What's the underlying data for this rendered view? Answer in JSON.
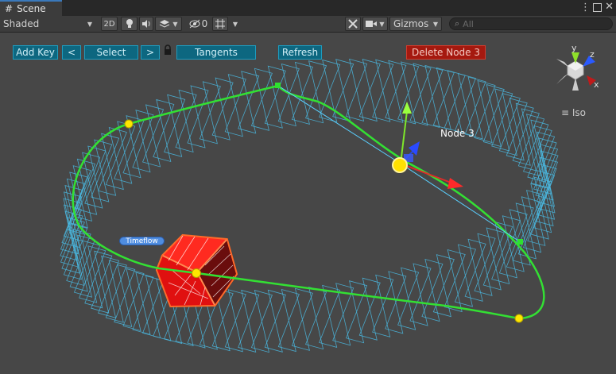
{
  "tab": {
    "title": "Scene"
  },
  "toolbar": {
    "shading_mode": "Shaded",
    "mode_2d": "2D",
    "hidden_count": "0",
    "gizmos_label": "Gizmos",
    "search_placeholder": "All"
  },
  "scene_buttons": {
    "add_key": "Add Key",
    "prev": "<",
    "select": "Select",
    "next": ">",
    "tangents": "Tangents",
    "refresh": "Refresh",
    "delete_node": "Delete Node 3"
  },
  "node_label": "Node 3",
  "timeflow_label": "Timeflow",
  "axis_gizmo": {
    "x": "x",
    "y": "y",
    "z": "z",
    "projection": "Iso"
  },
  "colors": {
    "accent_button": "#0d6780",
    "delete_button": "#a5190f",
    "spline": "#33e033",
    "frame_lines": "#4ab8e0",
    "selected_cube": "#e01010"
  }
}
